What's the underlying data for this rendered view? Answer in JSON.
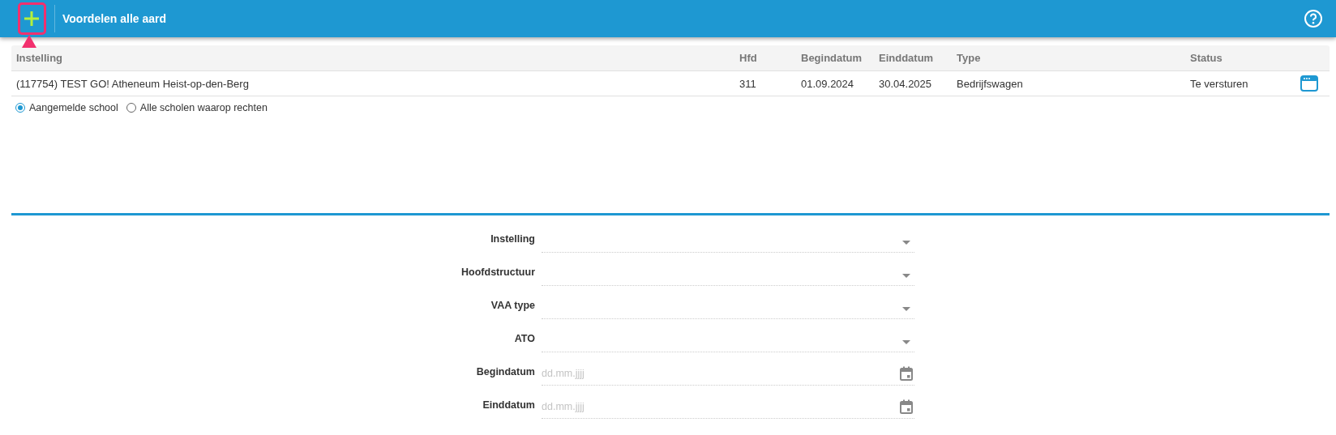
{
  "header": {
    "title": "Voordelen alle aard"
  },
  "table": {
    "columns": [
      "Instelling",
      "Hfd",
      "Begindatum",
      "Einddatum",
      "Type",
      "Status"
    ],
    "rows": [
      {
        "cells": [
          "(117754) TEST GO! Atheneum Heist-op-den-Berg",
          "311",
          "01.09.2024",
          "30.04.2025",
          "Bedrijfswagen",
          "Te versturen"
        ]
      }
    ]
  },
  "scope_options": [
    {
      "label": "Aangemelde school",
      "selected": true
    },
    {
      "label": "Alle scholen waarop rechten",
      "selected": false
    }
  ],
  "form": {
    "fields": [
      {
        "label": "Instelling",
        "kind": "select"
      },
      {
        "label": "Hoofdstructuur",
        "kind": "select"
      },
      {
        "label": "VAA type",
        "kind": "select"
      },
      {
        "label": "ATO",
        "kind": "select"
      },
      {
        "label": "Begindatum",
        "kind": "date",
        "placeholder": "dd.mm.jjjj"
      },
      {
        "label": "Einddatum",
        "kind": "date",
        "placeholder": "dd.mm.jjjj"
      }
    ]
  }
}
